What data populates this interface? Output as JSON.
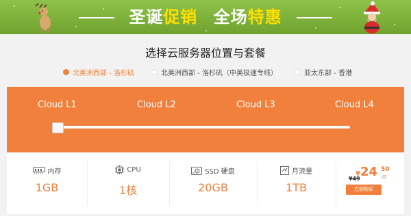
{
  "banner": {
    "title_part1": "圣诞",
    "title_part2": "促销",
    "title_part3": "全场",
    "title_part4": "特惠"
  },
  "heading": "选择云服务器位置与套餐",
  "regions": [
    {
      "label": "北美洲西部 - 洛杉矶",
      "selected": true
    },
    {
      "label": "北美洲西部 - 洛杉矶（中美极速专线）",
      "selected": false
    },
    {
      "label": "亚太东部 - 香港",
      "selected": false
    }
  ],
  "tiers": [
    "Cloud L1",
    "Cloud L2",
    "Cloud L3",
    "Cloud L4"
  ],
  "selected_tier_index": 0,
  "specs": {
    "memory": {
      "label": "内存",
      "value": "1GB",
      "icon": "memory-icon"
    },
    "cpu": {
      "label": "CPU",
      "value": "1核",
      "icon": "cpu-icon"
    },
    "disk": {
      "label": "SSD 硬盘",
      "value": "20GB",
      "icon": "disk-icon"
    },
    "traffic": {
      "label": "月流量",
      "value": "1TB",
      "icon": "traffic-icon"
    }
  },
  "price": {
    "currency": "¥",
    "original": "¥49",
    "integer": "24",
    "decimal": "50",
    "unit": "/月",
    "buy_label": "立即购买"
  },
  "colors": {
    "accent": "#f0803c",
    "banner_green": "#7db13a",
    "banner_highlight": "#ffde00"
  }
}
